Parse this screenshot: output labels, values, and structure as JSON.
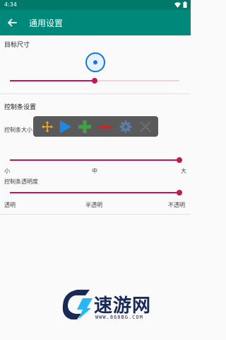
{
  "status_bar": {
    "time": "4:34"
  },
  "app_bar": {
    "title": "通用设置"
  },
  "target_size": {
    "title": "目标尺寸",
    "slider_value": 0.5
  },
  "control_bar_settings": {
    "title": "控制条设置",
    "toolbar_icons": [
      "move-icon",
      "play-icon",
      "plus-icon",
      "minus-icon",
      "gear-icon",
      "close-icon"
    ],
    "size": {
      "label": "控制条大小",
      "slider_value": 1.0,
      "ticks": [
        "小",
        "中",
        "大"
      ]
    },
    "opacity": {
      "label": "控制条透明度",
      "slider_value": 1.0,
      "ticks": [
        "透明",
        "半透明",
        "不透明"
      ]
    }
  },
  "watermark": {
    "text": "速游网",
    "url": "WWW.868BG.COM"
  },
  "colors": {
    "app_bar": "#00897b",
    "status_bar": "#00796b",
    "accent": "#c2185b",
    "target": "#1976d2"
  }
}
